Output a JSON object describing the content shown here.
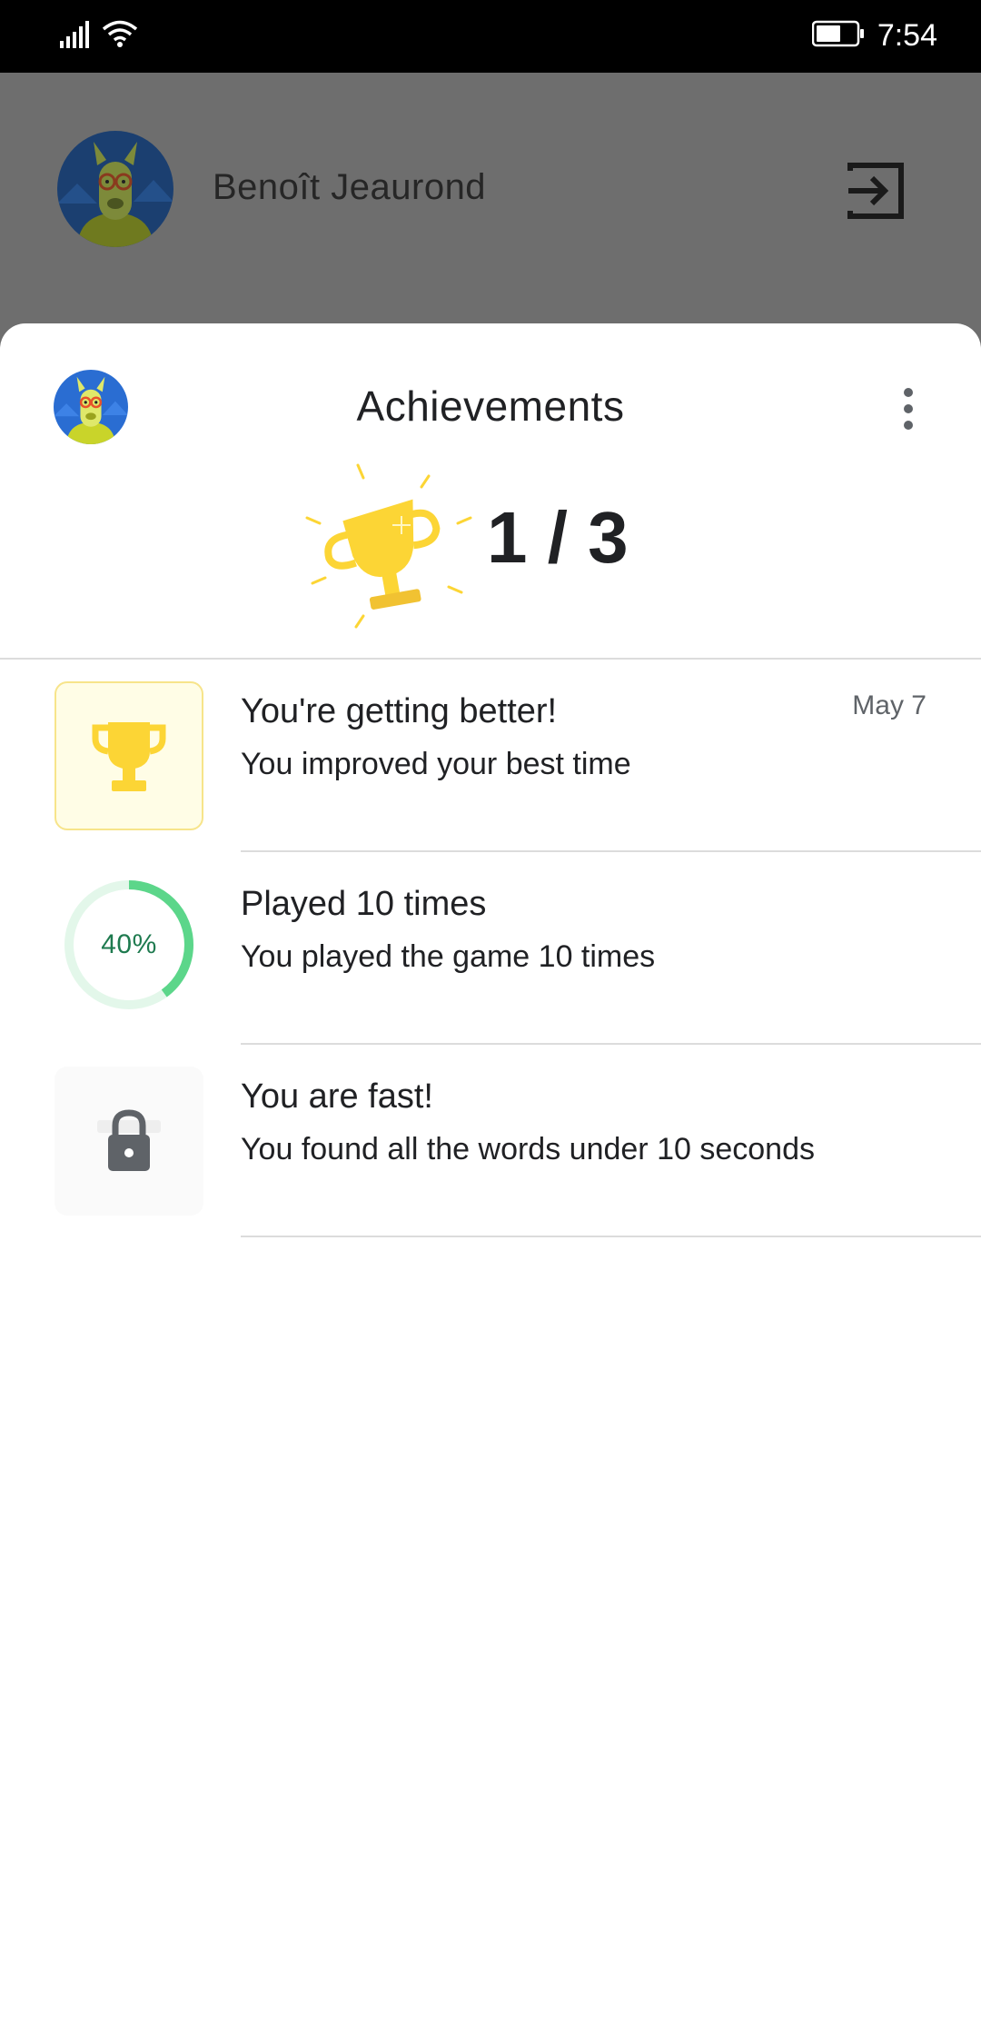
{
  "status_bar": {
    "time": "7:54",
    "icons": [
      "signal-icon",
      "wifi-icon",
      "battery-icon"
    ]
  },
  "profile": {
    "name": "Benoît Jeaurond",
    "avatar_icon": "llama-avatar-icon",
    "sign_out_icon": "exit-icon"
  },
  "achievements": {
    "title": "Achievements",
    "score": "1 / 3",
    "unlocked": 1,
    "total": 3,
    "items": [
      {
        "title": "You're getting better!",
        "description": "You improved your best time",
        "date": "May 7",
        "state": "unlocked",
        "icon": "trophy-icon"
      },
      {
        "title": "Played 10 times",
        "description": "You played the game 10 times",
        "state": "in-progress",
        "progress_percent": 40,
        "progress_label": "40%"
      },
      {
        "title": "You are fast!",
        "description": "You found all the words under 10 seconds",
        "state": "locked",
        "icon": "lock-icon"
      }
    ]
  },
  "colors": {
    "scrim": "#6e6e6e",
    "trophy_yellow": "#fcd535",
    "progress_green": "#5cd68a",
    "progress_track": "#e3f7ea",
    "text_primary": "#202124"
  }
}
